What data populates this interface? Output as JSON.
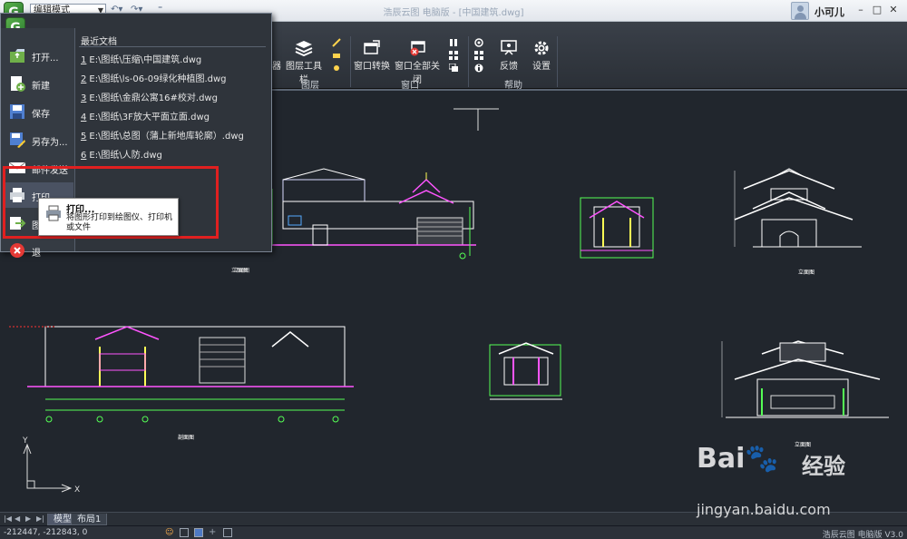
{
  "titlebar": {
    "logo_letter": "G",
    "mode_select": "编辑模式",
    "title": "浩辰云图 电脑版 - [中国建筑.dwg]",
    "user_name": "小可儿",
    "icons": [
      "minimize-icon",
      "maximize-icon",
      "close-icon"
    ]
  },
  "ribbon": {
    "buttons": {
      "layer_toolbar": "图层工具栏",
      "layer_partial": "器",
      "window_switch": "窗口转换",
      "window_close_all": "窗口全部关闭",
      "feedback": "反馈",
      "settings": "设置"
    },
    "groups": {
      "layers": "图层",
      "window": "窗口",
      "help": "帮助"
    }
  },
  "app_menu": {
    "items": [
      {
        "label": "打开...",
        "icon": "open-icon"
      },
      {
        "label": "新建",
        "icon": "new-icon"
      },
      {
        "label": "保存",
        "icon": "save-icon"
      },
      {
        "label": "另存为...",
        "icon": "save-as-icon"
      },
      {
        "label": "邮件发送",
        "icon": "mail-icon"
      },
      {
        "label": "打印...",
        "icon": "print-icon"
      },
      {
        "label": "图",
        "icon": "export-icon"
      },
      {
        "label": "退",
        "icon": "exit-icon"
      }
    ],
    "recent_title": "最近文档",
    "recent": [
      {
        "num": "1",
        "path": "E:\\图纸\\压缩\\中国建筑.dwg"
      },
      {
        "num": "2",
        "path": "E:\\图纸\\ls-06-09绿化种植图.dwg"
      },
      {
        "num": "3",
        "path": "E:\\图纸\\金鼎公寓16#校对.dwg"
      },
      {
        "num": "4",
        "path": "E:\\图纸\\3F放大平面立面.dwg"
      },
      {
        "num": "5",
        "path": "E:\\图纸\\总图（蒲上新地库轮廓）.dwg"
      },
      {
        "num": "6",
        "path": "E:\\图纸\\人防.dwg"
      }
    ]
  },
  "tooltip": {
    "title": "打印...",
    "description": "将图形打印到绘图仪、打印机或文件"
  },
  "drawing": {
    "captions": [
      "立面图",
      "立面图",
      "剖面图",
      "立面图"
    ]
  },
  "tabs": {
    "model": "模型",
    "layout1": "布局1"
  },
  "status": {
    "coords": "-212447, -212843, 0",
    "version": "浩辰云图 电脑版 V3.0"
  },
  "watermark": {
    "brand": "Bai",
    "brand_suffix": "经验",
    "url": "jingyan.baidu.com"
  },
  "colors": {
    "highlight": "#e02020",
    "canvas": "#21262d",
    "ribbon": "#2b3037"
  }
}
